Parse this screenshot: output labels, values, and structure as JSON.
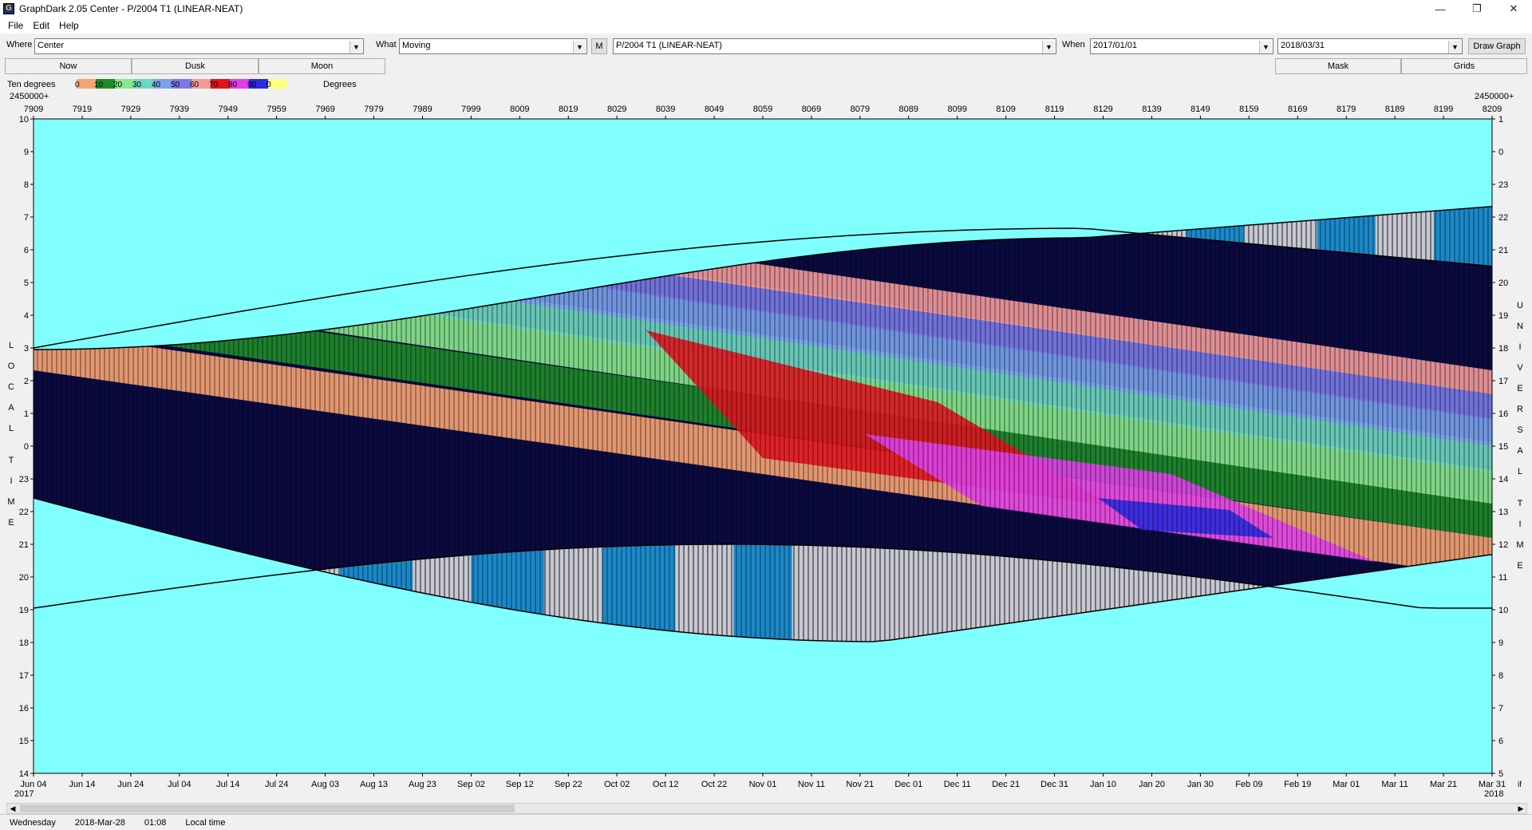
{
  "window": {
    "title": "GraphDark 2.05  Center  -  P/2004 T1 (LINEAR-NEAT)",
    "minimize": "—",
    "restore": "❐",
    "close": "✕"
  },
  "menu": [
    "File",
    "Edit",
    "Help"
  ],
  "toolbar": {
    "where_label": "Where",
    "where_value": "Center",
    "what_label": "What",
    "what_value": "Moving",
    "m_button": "M",
    "object_value": "P/2004 T1 (LINEAR-NEAT)",
    "when_label": "When",
    "start_date": "2017/01/01",
    "end_date": "2018/03/31",
    "draw_button": "Draw Graph"
  },
  "tabs": {
    "now": "Now",
    "dusk": "Dusk",
    "moon": "Moon",
    "mask": "Mask",
    "grids": "Grids"
  },
  "legend": {
    "title": "Ten degrees",
    "unit": "Degrees",
    "items": [
      {
        "label": "0",
        "color": "#f4a373"
      },
      {
        "label": "10",
        "color": "#1f8a2a"
      },
      {
        "label": "20",
        "color": "#88e68c"
      },
      {
        "label": "30",
        "color": "#6fd7bf"
      },
      {
        "label": "40",
        "color": "#7aa2ec"
      },
      {
        "label": "50",
        "color": "#7a7ae6"
      },
      {
        "label": "60",
        "color": "#f09a9a"
      },
      {
        "label": "70",
        "color": "#e0141e"
      },
      {
        "label": "80",
        "color": "#e040e8"
      },
      {
        "label": "90",
        "color": "#2a2ae0"
      },
      {
        "label": "0",
        "color": "#ffff80"
      }
    ]
  },
  "chart_data": {
    "type": "other",
    "top_axis_prefix": "2450000+",
    "top_axis_prefix_right": "2450000+",
    "jd_ticks": [
      "7909",
      "7919",
      "7929",
      "7939",
      "7949",
      "7959",
      "7969",
      "7979",
      "7989",
      "7999",
      "8009",
      "8019",
      "8029",
      "8039",
      "8049",
      "8059",
      "8069",
      "8079",
      "8089",
      "8099",
      "8109",
      "8119",
      "8129",
      "8139",
      "8149",
      "8159",
      "8169",
      "8179",
      "8189",
      "8199",
      "8209"
    ],
    "date_ticks": [
      "Jun 04",
      "Jun 14",
      "Jun 24",
      "Jul 04",
      "Jul 14",
      "Jul 24",
      "Aug 03",
      "Aug 13",
      "Aug 23",
      "Sep 02",
      "Sep 12",
      "Sep 22",
      "Oct 02",
      "Oct 12",
      "Oct 22",
      "Nov 01",
      "Nov 11",
      "Nov 21",
      "Dec 01",
      "Dec 11",
      "Dec 21",
      "Dec 31",
      "Jan 10",
      "Jan 20",
      "Jan 30",
      "Feb 09",
      "Feb 19",
      "Mar 01",
      "Mar 11",
      "Mar 21",
      "Mar 31"
    ],
    "year_left": "2017",
    "year_right": "2018",
    "right_bottom_label": "if",
    "left_hours": [
      "10",
      "9",
      "8",
      "7",
      "6",
      "5",
      "4",
      "3",
      "2",
      "1",
      "0",
      "23",
      "22",
      "21",
      "20",
      "19",
      "18",
      "17",
      "16",
      "15",
      "14"
    ],
    "right_hours": [
      "1",
      "0",
      "23",
      "22",
      "21",
      "20",
      "19",
      "18",
      "17",
      "16",
      "15",
      "14",
      "13",
      "12",
      "11",
      "10",
      "9",
      "8",
      "7",
      "6",
      "5"
    ],
    "left_axis_label": "LOCAL TIME",
    "right_axis_label": "UNIVERSAL TIME",
    "sky_color": "#80ffff",
    "night_color": "#0a0a40",
    "twilight_light": "#c8c8d2",
    "twilight_blue": "#1a88c8"
  },
  "status": {
    "day": "Wednesday",
    "date": "2018-Mar-28",
    "time": "01:08",
    "zone": "Local time"
  }
}
